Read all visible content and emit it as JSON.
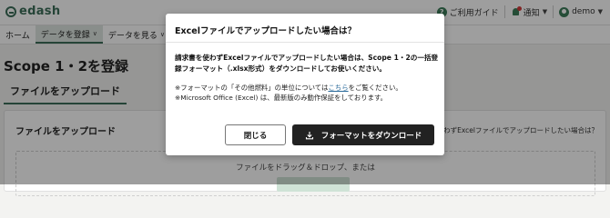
{
  "header": {
    "logo_text": "edash",
    "guide_label": "ご利用ガイド",
    "notify_label": "通知",
    "user_label": "demo"
  },
  "nav": {
    "items": [
      {
        "label": "ホーム"
      },
      {
        "label": "データを登録"
      },
      {
        "label": "データを見る"
      }
    ]
  },
  "page": {
    "title": "Scope 1・2を登録",
    "tab_label": "ファイルをアップロード",
    "card_title": "ファイルをアップロード",
    "card_link": "請求書を使わずExcelファイルでアップロードしたい場合は？",
    "drop_text": "ファイルをドラッグ＆ドロップ、または"
  },
  "modal": {
    "title": "Excelファイルでアップロードしたい場合は？",
    "body_line1": "請求書を使わずExcelファイルでアップロードしたい場合は、Scope 1・2の一括登",
    "body_line2": "録フォーマット（.xlsx形式）をダウンロードしてお使いください。",
    "note1_prefix": "※フォーマットの「その他燃料」の単位については",
    "note1_link": "こちら",
    "note1_suffix": "をご覧ください。",
    "note2": "※Microsoft Office (Excel) は、最新版のみ動作保証をしております。",
    "close_label": "閉じる",
    "download_label": "フォーマットをダウンロード"
  },
  "colors": {
    "brand": "#3c6e5a",
    "download_button": "#222222",
    "overlay": "rgba(0,0,0,0.38)"
  }
}
